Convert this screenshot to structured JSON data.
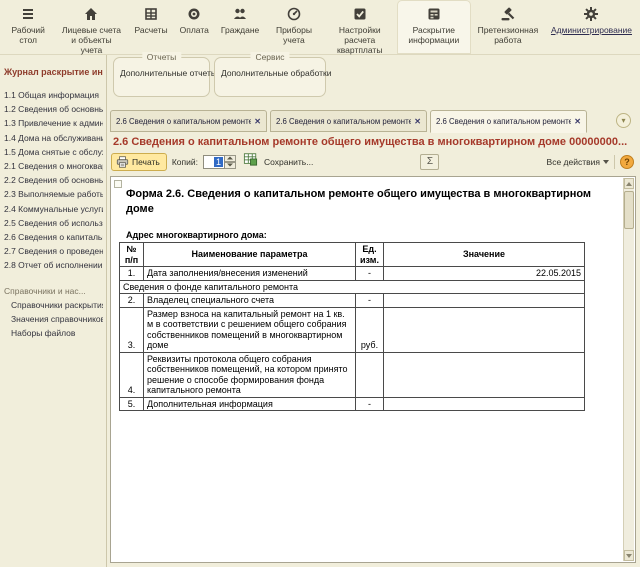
{
  "colors": {
    "background": "#f1eedb",
    "title_accent": "#a5392a",
    "sidebar_header": "#8e3b2b",
    "selection_blue": "#316ac5",
    "help_orange": "#f2a93e",
    "print_highlight": "#ffe9a0"
  },
  "icons": {
    "close": "✕",
    "chevron_down": "▾"
  },
  "top_nav": {
    "items": [
      {
        "label": "Рабочий стол",
        "icon": "desktop",
        "active": false,
        "link": false
      },
      {
        "label": "Лицевые счета и объекты учета",
        "icon": "house",
        "active": false,
        "link": false
      },
      {
        "label": "Расчеты",
        "icon": "register",
        "active": false,
        "link": false
      },
      {
        "label": "Оплата",
        "icon": "coin",
        "active": false,
        "link": false
      },
      {
        "label": "Граждане",
        "icon": "citizens",
        "active": false,
        "link": false
      },
      {
        "label": "Приборы учета",
        "icon": "gauge",
        "active": false,
        "link": false
      },
      {
        "label": "Настройки расчета квартплаты",
        "icon": "checkbox",
        "active": false,
        "link": false
      },
      {
        "label": "Раскрытие информации",
        "icon": "disclosure",
        "active": true,
        "link": false
      },
      {
        "label": "Претензионная работа",
        "icon": "gavel",
        "active": false,
        "link": false
      },
      {
        "label": "Администрирование",
        "icon": "gear",
        "active": false,
        "link": true
      }
    ]
  },
  "sidebar": {
    "header": "Журнал раскрытие ин...",
    "items": [
      "1.1 Общая информация",
      "1.2 Сведения об основных ...",
      "1.3 Привлечение к админи...",
      "1.4 Дома на обслуживании",
      "1.5 Дома снятые с обслуж...",
      "2.1 Сведения о многокварт...",
      "2.2 Сведения об основных ...",
      "2.3 Выполняемые работы ...",
      "2.4 Коммунальные услуги ...",
      "2.5 Сведения об использов...",
      "2.6 Сведения о капитально...",
      "2.7 Сведения о проведенн...",
      "2.8 Отчет об исполнении д..."
    ],
    "group_header": "Справочники и нас...",
    "group_items": [
      "Справочники раскрытия ...",
      "Значения справочников ...",
      "Наборы файлов"
    ]
  },
  "panels": {
    "reports": {
      "legend": "Отчеты",
      "item": "Дополнительные отчеты"
    },
    "service": {
      "legend": "Сервис",
      "item": "Дополнительные обработки"
    }
  },
  "tabs": [
    {
      "label": "2.6 Сведения о капитальном ремонте об...",
      "active": false
    },
    {
      "label": "2.6 Сведения о капитальном ремонте общ...",
      "active": false
    },
    {
      "label": "2.6 Сведения о капитальном ремонте общ...",
      "active": true
    }
  ],
  "page": {
    "title": "2.6 Сведения о капитальном ремонте общего имущества в многоквартирном доме 00000000..."
  },
  "toolbar": {
    "print_label": "Печать",
    "copies_label": "Копий:",
    "copies_value": "1",
    "save_label": "Сохранить...",
    "sigma_label": "Σ",
    "all_actions_label": "Все действия",
    "help_label": "?"
  },
  "document": {
    "heading": "Форма 2.6. Сведения о капитальном ремонте общего имущества в многоквартирном доме",
    "address_label": "Адрес многоквартирного дома:",
    "table": {
      "headers": {
        "num": "№ п/п",
        "name": "Наименование параметра",
        "unit": "Ед. изм.",
        "value": "Значение"
      },
      "rows": [
        {
          "type": "data",
          "num": "1.",
          "name": "Дата заполнения/внесения изменений",
          "unit": "-",
          "value": "22.05.2015"
        },
        {
          "type": "section",
          "name": "Сведения о фонде капитального ремонта"
        },
        {
          "type": "data",
          "num": "2.",
          "name": "Владелец специального счета",
          "unit": "-",
          "value": ""
        },
        {
          "type": "data",
          "num": "3.",
          "name": "Размер взноса на капитальный ремонт на 1 кв. м в соответствии с решением общего собрания собственников помещений в многоквартирном доме",
          "unit": "руб.",
          "value": ""
        },
        {
          "type": "data",
          "num": "4.",
          "name": "Реквизиты протокола общего собрания собственников помещений, на котором принято решение о способе формирования фонда капитального ремонта",
          "unit": "",
          "value": ""
        },
        {
          "type": "data",
          "num": "5.",
          "name": "Дополнительная информация",
          "unit": "-",
          "value": ""
        }
      ]
    }
  }
}
